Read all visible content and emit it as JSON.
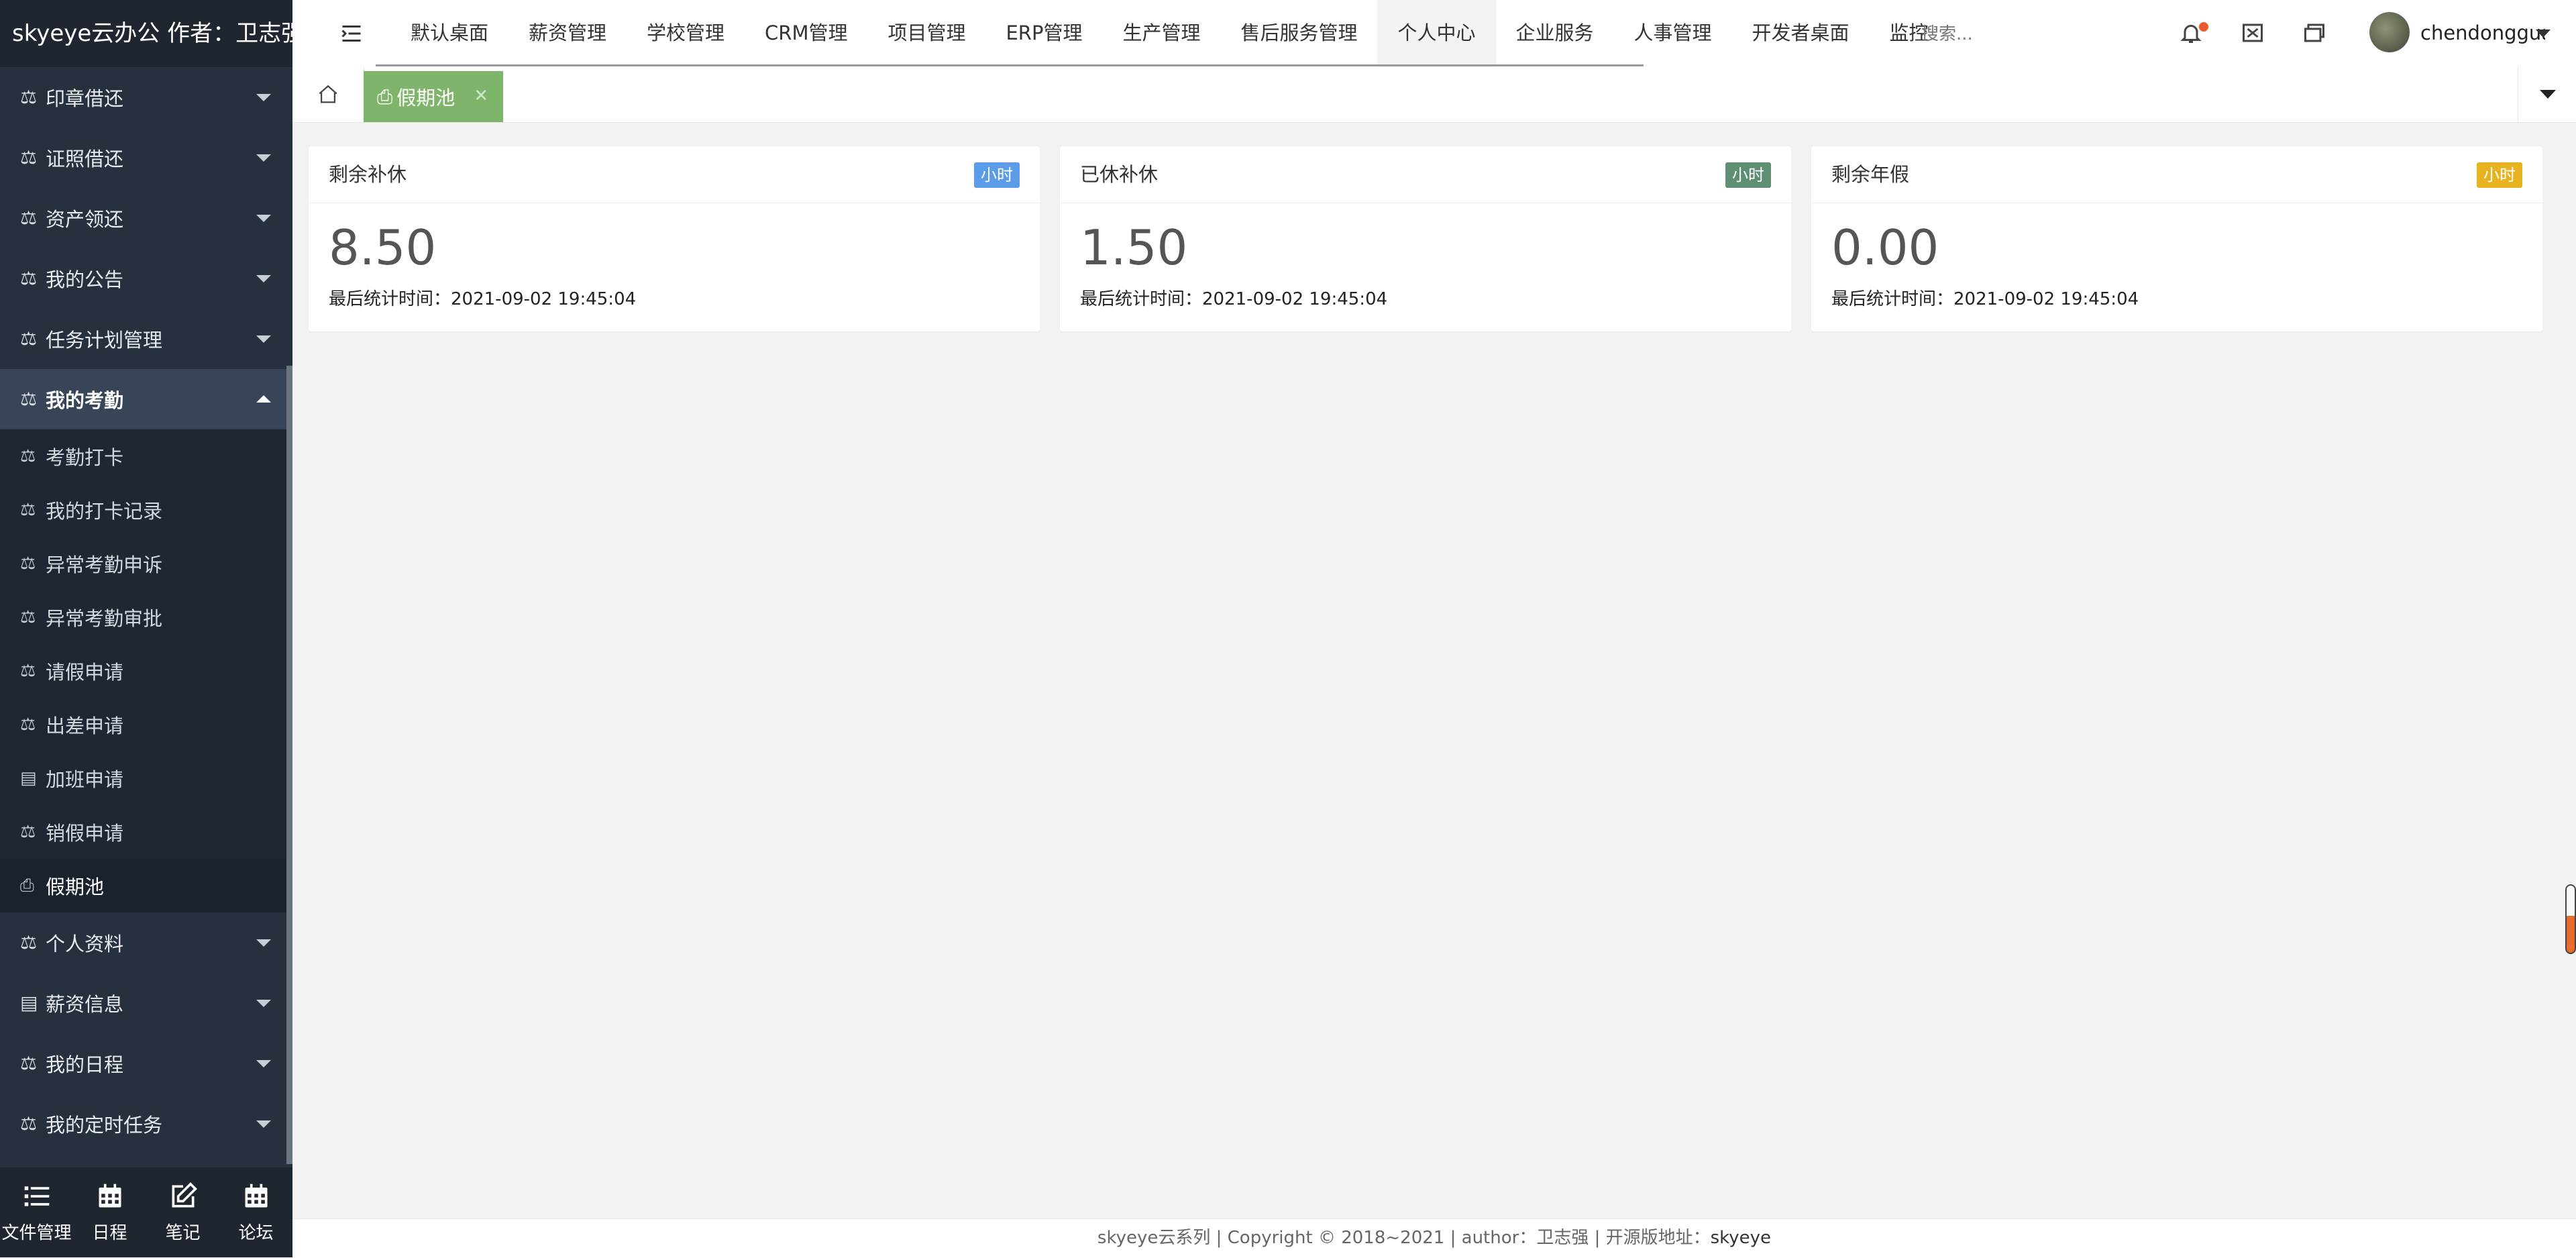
{
  "app": {
    "brand": "skyeye云办公 作者：卫志强"
  },
  "sidebar": {
    "groups_top": [
      {
        "label": "印章借还",
        "icon": "balance-icon"
      },
      {
        "label": "证照借还",
        "icon": "balance-icon"
      },
      {
        "label": "资产领还",
        "icon": "balance-icon"
      },
      {
        "label": "我的公告",
        "icon": "balance-icon"
      },
      {
        "label": "任务计划管理",
        "icon": "balance-icon"
      }
    ],
    "open_group": {
      "label": "我的考勤",
      "icon": "balance-icon"
    },
    "sub_items": [
      {
        "label": "考勤打卡",
        "icon": "balance-icon"
      },
      {
        "label": "我的打卡记录",
        "icon": "balance-icon"
      },
      {
        "label": "异常考勤申诉",
        "icon": "balance-icon"
      },
      {
        "label": "异常考勤审批",
        "icon": "balance-icon"
      },
      {
        "label": "请假申请",
        "icon": "balance-icon"
      },
      {
        "label": "出差申请",
        "icon": "balance-icon"
      },
      {
        "label": "加班申请",
        "icon": "archive-icon"
      },
      {
        "label": "销假申请",
        "icon": "balance-icon"
      },
      {
        "label": "假期池",
        "icon": "printer-icon",
        "active": true
      }
    ],
    "groups_bottom": [
      {
        "label": "个人资料",
        "icon": "balance-icon"
      },
      {
        "label": "薪资信息",
        "icon": "archive-icon"
      },
      {
        "label": "我的日程",
        "icon": "balance-icon"
      },
      {
        "label": "我的定时任务",
        "icon": "balance-icon"
      }
    ],
    "bottom_tools": [
      {
        "label": "文件管理",
        "icon": "list-icon"
      },
      {
        "label": "日程",
        "icon": "calendar-icon"
      },
      {
        "label": "笔记",
        "icon": "edit-icon"
      },
      {
        "label": "论坛",
        "icon": "calendar-icon"
      }
    ]
  },
  "topnav": {
    "tabs": [
      "默认桌面",
      "薪资管理",
      "学校管理",
      "CRM管理",
      "项目管理",
      "ERP管理",
      "生产管理",
      "售后服务管理",
      "个人中心",
      "企业服务",
      "人事管理",
      "开发者桌面",
      "监控"
    ],
    "active_tab": "个人中心",
    "search_placeholder": "搜索...",
    "username": "chendonggua"
  },
  "page_tabs": {
    "current": "假期池"
  },
  "cards": [
    {
      "title": "剩余补休",
      "badge": "小时",
      "badge_color": "#5a9ce8",
      "value": "8.50",
      "meta_label": "最后统计时间：",
      "meta_value": "2021-09-02 19:45:04"
    },
    {
      "title": "已休补休",
      "badge": "小时",
      "badge_color": "#5f8f73",
      "value": "1.50",
      "meta_label": "最后统计时间：",
      "meta_value": "2021-09-02 19:45:04"
    },
    {
      "title": "剩余年假",
      "badge": "小时",
      "badge_color": "#e8b321",
      "value": "0.00",
      "meta_label": "最后统计时间：",
      "meta_value": "2021-09-02 19:45:04"
    }
  ],
  "footer": {
    "text": "skyeye云系列 | Copyright © 2018~2021 | author：卫志强 | 开源版地址：",
    "link": "skyeye"
  }
}
